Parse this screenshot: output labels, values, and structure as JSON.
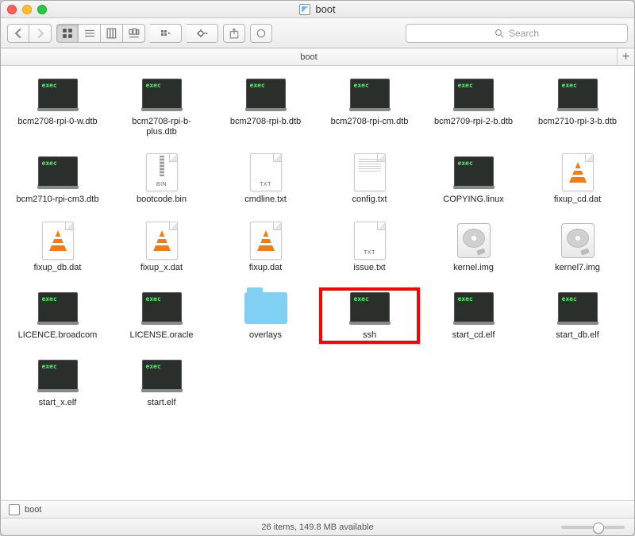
{
  "window": {
    "title": "boot"
  },
  "pathbar": {
    "label": "boot"
  },
  "locationbar": {
    "label": "boot"
  },
  "statusbar": {
    "text": "26 items, 149.8 MB available"
  },
  "search": {
    "placeholder": "Search"
  },
  "files": [
    {
      "name": "bcm2708-rpi-0-w.dtb",
      "icon": "exec"
    },
    {
      "name": "bcm2708-rpi-b-plus.dtb",
      "icon": "exec"
    },
    {
      "name": "bcm2708-rpi-b.dtb",
      "icon": "exec"
    },
    {
      "name": "bcm2708-rpi-cm.dtb",
      "icon": "exec"
    },
    {
      "name": "bcm2709-rpi-2-b.dtb",
      "icon": "exec"
    },
    {
      "name": "bcm2710-rpi-3-b.dtb",
      "icon": "exec"
    },
    {
      "name": "bcm2710-rpi-cm3.dtb",
      "icon": "exec"
    },
    {
      "name": "bootcode.bin",
      "icon": "bin"
    },
    {
      "name": "cmdline.txt",
      "icon": "txt"
    },
    {
      "name": "config.txt",
      "icon": "txt-lines"
    },
    {
      "name": "COPYING.linux",
      "icon": "exec"
    },
    {
      "name": "fixup_cd.dat",
      "icon": "vlc"
    },
    {
      "name": "fixup_db.dat",
      "icon": "vlc"
    },
    {
      "name": "fixup_x.dat",
      "icon": "vlc"
    },
    {
      "name": "fixup.dat",
      "icon": "vlc"
    },
    {
      "name": "issue.txt",
      "icon": "txt"
    },
    {
      "name": "kernel.img",
      "icon": "hdd"
    },
    {
      "name": "kernel7.img",
      "icon": "hdd"
    },
    {
      "name": "LICENCE.broadcom",
      "icon": "exec"
    },
    {
      "name": "LICENSE.oracle",
      "icon": "exec"
    },
    {
      "name": "overlays",
      "icon": "folder"
    },
    {
      "name": "ssh",
      "icon": "exec",
      "highlight": true
    },
    {
      "name": "start_cd.elf",
      "icon": "exec"
    },
    {
      "name": "start_db.elf",
      "icon": "exec"
    },
    {
      "name": "start_x.elf",
      "icon": "exec"
    },
    {
      "name": "start.elf",
      "icon": "exec"
    }
  ]
}
